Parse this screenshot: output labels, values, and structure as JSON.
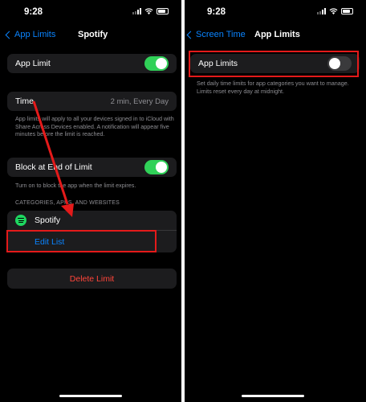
{
  "status_bar": {
    "time": "9:28"
  },
  "left": {
    "back_label": "App Limits",
    "title": "Spotify",
    "app_limit_label": "App Limit",
    "time_label": "Time",
    "time_value": "2 min, Every Day",
    "time_footer": "App limits will apply to all your devices signed in to iCloud with Share Across Devices enabled. A notification will appear five minutes before the limit is reached.",
    "block_label": "Block at End of Limit",
    "block_footer": "Turn on to block the app when the limit expires.",
    "section_header": "CATEGORIES, APPS, AND WEBSITES",
    "app_name": "Spotify",
    "edit_list": "Edit List",
    "delete_limit": "Delete Limit"
  },
  "right": {
    "back_label": "Screen Time",
    "title": "App Limits",
    "app_limits_label": "App Limits",
    "footer": "Set daily time limits for app categories you want to manage. Limits reset every day at midnight."
  },
  "colors": {
    "accent": "#0a84ff",
    "toggle_on": "#30d158",
    "destructive": "#ff453a",
    "annotation": "#e41a1a"
  }
}
